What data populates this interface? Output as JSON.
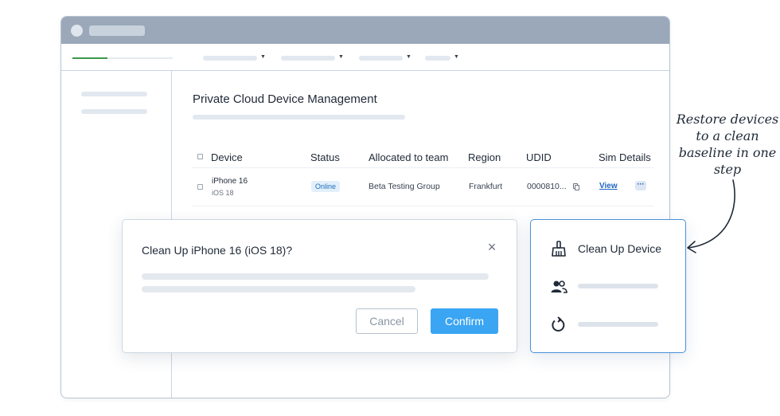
{
  "nav": {
    "progress_fraction": 0.35
  },
  "main": {
    "title": "Private Cloud Device Management",
    "table": {
      "headers": [
        "Device",
        "Status",
        "Allocated to team",
        "Region",
        "UDID",
        "Sim Details"
      ],
      "row": {
        "device": "iPhone 16",
        "os": "iOS 18",
        "status": "Online",
        "team": "Beta Testing Group",
        "region": "Frankfurt",
        "udid": "0000810...",
        "view_label": "View",
        "more_label": "···"
      }
    }
  },
  "dialog": {
    "title": "Clean Up iPhone 16 (iOS 18)?",
    "close_glyph": "×",
    "cancel_label": "Cancel",
    "confirm_label": "Confirm"
  },
  "panel": {
    "clean_up_label": "Clean Up Device",
    "icons": [
      "broom-icon",
      "users-icon",
      "restore-icon"
    ]
  },
  "annotation": {
    "text": "Restore devices to a clean baseline in one step"
  },
  "colors": {
    "accent": "#3aa5f2",
    "panel_border": "#4a90d9",
    "titlebar": "#9aa8b9",
    "progress": "#3b9a4b",
    "status_badge_text": "#1e6fb8"
  }
}
